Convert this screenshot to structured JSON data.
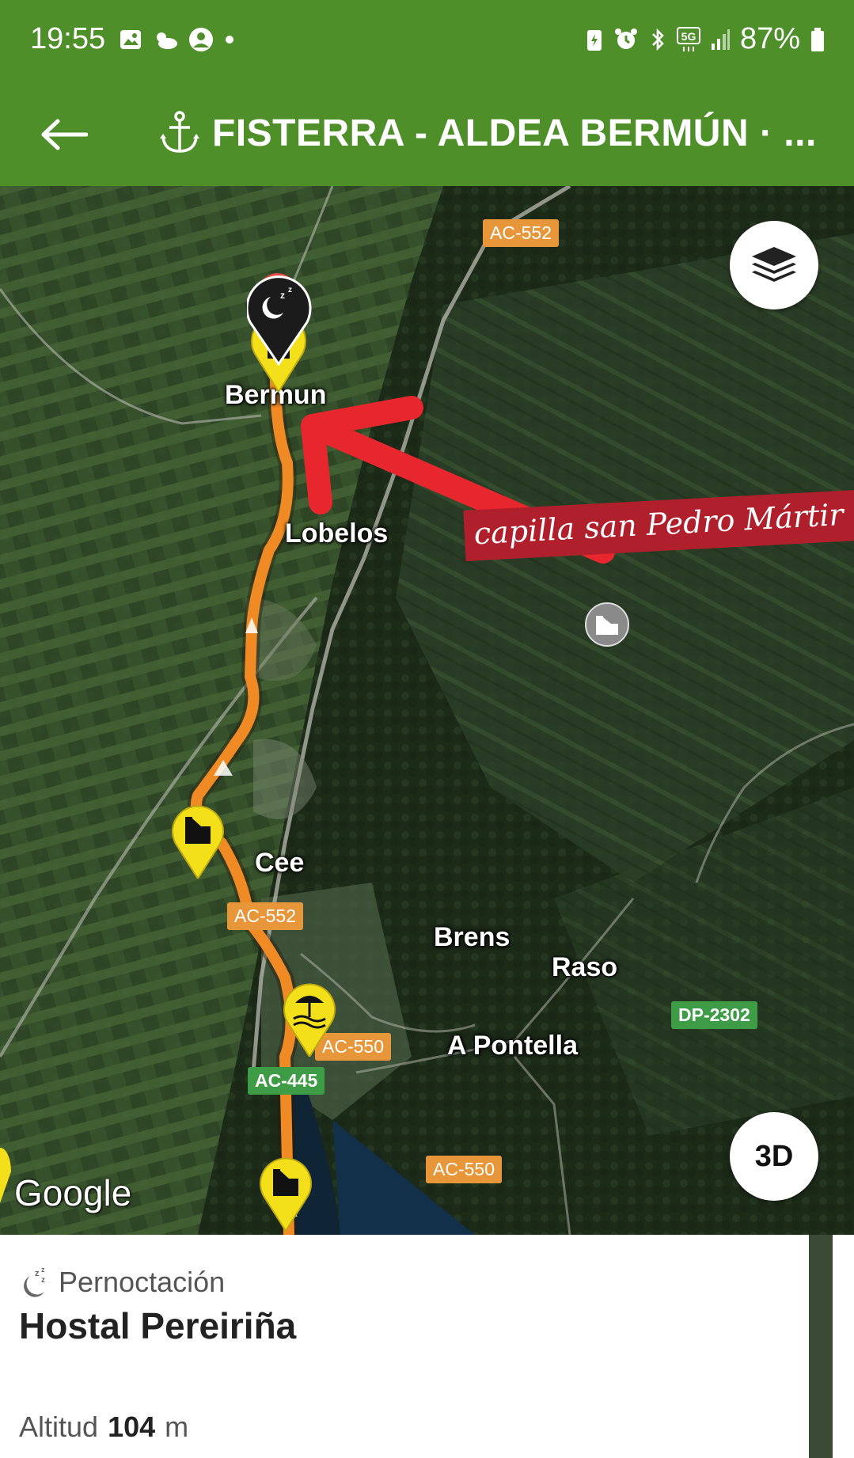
{
  "status_bar": {
    "time": "19:55",
    "network": "5G",
    "battery": "87%"
  },
  "toolbar": {
    "title": "FISTERRA - ALDEA BERMÚN · ..."
  },
  "map": {
    "road_labels": [
      "AC-552",
      "AC-552",
      "AC-550",
      "AC-445",
      "AC-550",
      "DP-2302"
    ],
    "places": [
      "Bermun",
      "Lobelos",
      "Cee",
      "Brens",
      "Raso",
      "A Pontella"
    ],
    "annotation": "capilla san Pedro Mártir",
    "button_3d": "3D",
    "attribution": "Google",
    "colors": {
      "route": "#f08a24",
      "arrow": "#e8262e",
      "marker": "#f4e01a",
      "app_green": "#4f8f2a"
    }
  },
  "sheet": {
    "category": "Pernoctación",
    "name": "Hostal Pereiriña",
    "altitude_label": "Altitud",
    "altitude_value": "104",
    "altitude_unit": "m"
  }
}
